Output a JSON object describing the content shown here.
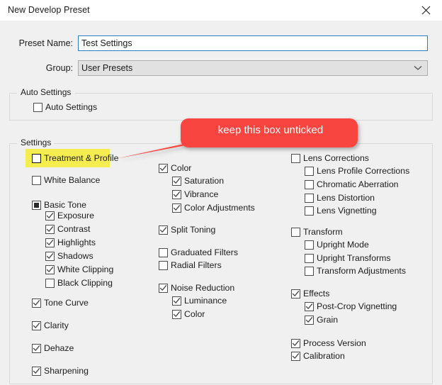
{
  "window": {
    "title": "New Develop Preset",
    "close_icon": "close-icon"
  },
  "form": {
    "preset_name_label": "Preset Name:",
    "preset_name_value": "Test Settings",
    "preset_name_placeholder": "",
    "group_label": "Group:",
    "group_value": "User Presets",
    "group_chevron_icon": "chevron-down-icon"
  },
  "auto_settings_group": {
    "legend": "Auto Settings",
    "checkbox": {
      "label": "Auto Settings",
      "state": "unchecked"
    }
  },
  "settings_group": {
    "legend": "Settings",
    "column1": [
      {
        "label": "Treatment & Profile",
        "state": "unchecked",
        "indent": 0,
        "highlighted": true
      },
      {
        "label": "White Balance",
        "state": "unchecked",
        "indent": 0
      },
      {
        "label": "Basic Tone",
        "state": "indeterminate",
        "indent": 0
      },
      {
        "label": "Exposure",
        "state": "checked",
        "indent": 1
      },
      {
        "label": "Contrast",
        "state": "checked",
        "indent": 1
      },
      {
        "label": "Highlights",
        "state": "checked",
        "indent": 1
      },
      {
        "label": "Shadows",
        "state": "checked",
        "indent": 1
      },
      {
        "label": "White Clipping",
        "state": "checked",
        "indent": 1
      },
      {
        "label": "Black Clipping",
        "state": "unchecked",
        "indent": 1
      },
      {
        "label": "Tone Curve",
        "state": "checked",
        "indent": 0
      },
      {
        "label": "Clarity",
        "state": "checked",
        "indent": 0
      },
      {
        "label": "Dehaze",
        "state": "checked",
        "indent": 0
      },
      {
        "label": "Sharpening",
        "state": "checked",
        "indent": 0
      }
    ],
    "column2": [
      {
        "label": "Color",
        "state": "checked",
        "indent": 0
      },
      {
        "label": "Saturation",
        "state": "checked",
        "indent": 1
      },
      {
        "label": "Vibrance",
        "state": "checked",
        "indent": 1
      },
      {
        "label": "Color Adjustments",
        "state": "checked",
        "indent": 1
      },
      {
        "label": "Split Toning",
        "state": "checked",
        "indent": 0
      },
      {
        "label": "Graduated Filters",
        "state": "unchecked",
        "indent": 0
      },
      {
        "label": "Radial Filters",
        "state": "unchecked",
        "indent": 0
      },
      {
        "label": "Noise Reduction",
        "state": "checked",
        "indent": 0
      },
      {
        "label": "Luminance",
        "state": "checked",
        "indent": 1
      },
      {
        "label": "Color",
        "state": "checked",
        "indent": 1
      }
    ],
    "column3": [
      {
        "label": "Lens Corrections",
        "state": "unchecked",
        "indent": 0
      },
      {
        "label": "Lens Profile Corrections",
        "state": "unchecked",
        "indent": 1
      },
      {
        "label": "Chromatic Aberration",
        "state": "unchecked",
        "indent": 1
      },
      {
        "label": "Lens Distortion",
        "state": "unchecked",
        "indent": 1
      },
      {
        "label": "Lens Vignetting",
        "state": "unchecked",
        "indent": 1
      },
      {
        "label": "Transform",
        "state": "unchecked",
        "indent": 0
      },
      {
        "label": "Upright Mode",
        "state": "unchecked",
        "indent": 1
      },
      {
        "label": "Upright Transforms",
        "state": "unchecked",
        "indent": 1
      },
      {
        "label": "Transform Adjustments",
        "state": "unchecked",
        "indent": 1
      },
      {
        "label": "Effects",
        "state": "checked",
        "indent": 0
      },
      {
        "label": "Post-Crop Vignetting",
        "state": "checked",
        "indent": 1
      },
      {
        "label": "Grain",
        "state": "checked",
        "indent": 1
      },
      {
        "label": "Process Version",
        "state": "checked",
        "indent": 0
      },
      {
        "label": "Calibration",
        "state": "checked",
        "indent": 0
      }
    ]
  },
  "annotation": {
    "text": "keep this box unticked",
    "bubble_color": "#f9453f",
    "text_color": "#ffffff",
    "highlight_color": "#f5ec50",
    "points_at": "Treatment & Profile"
  }
}
